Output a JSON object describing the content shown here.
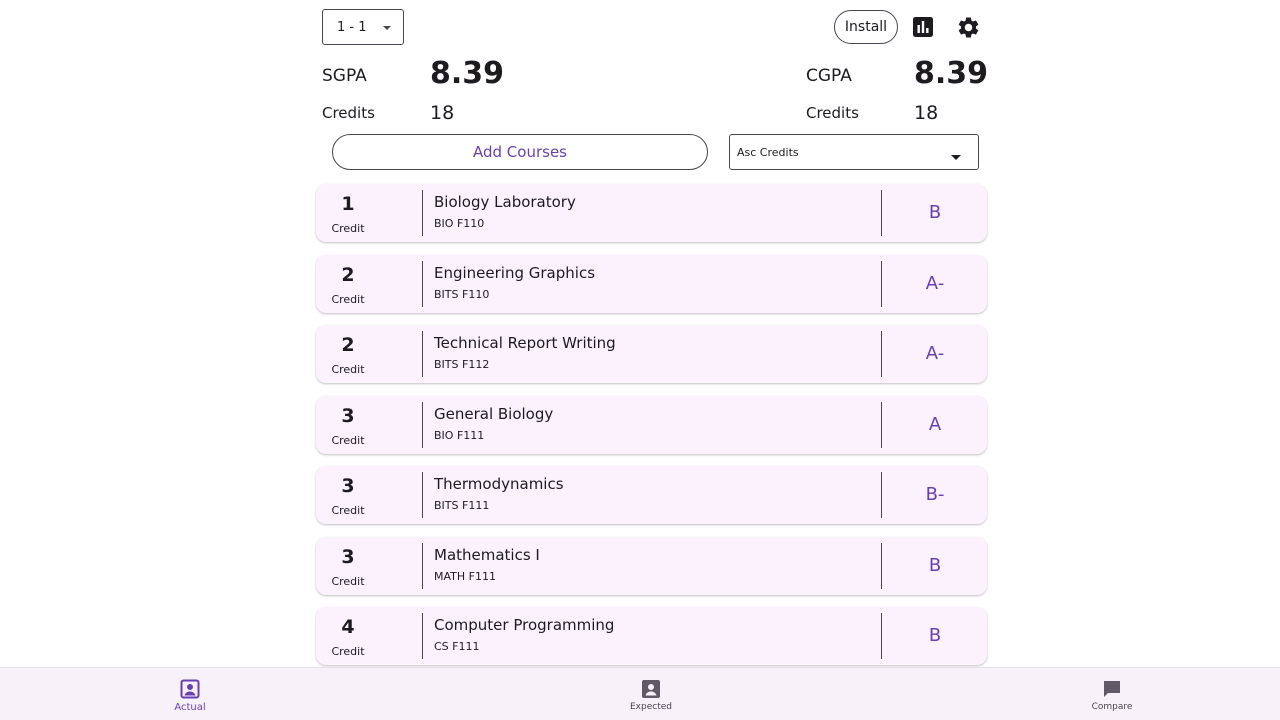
{
  "header": {
    "semester_value": "1 - 1",
    "install_label": "Install",
    "stats_icon": "bar-chart-icon",
    "settings_icon": "gear-icon"
  },
  "sgpa": {
    "label": "SGPA",
    "value": "8.39",
    "credits_label": "Credits",
    "credits_value": "18"
  },
  "cgpa": {
    "label": "CGPA",
    "value": "8.39",
    "credits_label": "Credits",
    "credits_value": "18"
  },
  "controls": {
    "add_courses_label": "Add Courses",
    "sort_value": "Asc Credits"
  },
  "courses": [
    {
      "credits": "1",
      "credit_label": "Credit",
      "name": "Biology Laboratory",
      "code": "BIO F110",
      "grade": "B"
    },
    {
      "credits": "2",
      "credit_label": "Credit",
      "name": "Engineering Graphics",
      "code": "BITS F110",
      "grade": "A-"
    },
    {
      "credits": "2",
      "credit_label": "Credit",
      "name": "Technical Report Writing",
      "code": "BITS F112",
      "grade": "A-"
    },
    {
      "credits": "3",
      "credit_label": "Credit",
      "name": "General Biology",
      "code": "BIO F111",
      "grade": "A"
    },
    {
      "credits": "3",
      "credit_label": "Credit",
      "name": "Thermodynamics",
      "code": "BITS F111",
      "grade": "B-"
    },
    {
      "credits": "3",
      "credit_label": "Credit",
      "name": "Mathematics I",
      "code": "MATH F111",
      "grade": "B"
    },
    {
      "credits": "4",
      "credit_label": "Credit",
      "name": "Computer Programming",
      "code": "CS F111",
      "grade": "B"
    }
  ],
  "nav": {
    "actual_label": "Actual",
    "expected_label": "Expected",
    "compare_label": "Compare"
  },
  "colors": {
    "accent": "#6a3fb1",
    "card_bg": "#fbf2fd",
    "nav_bg": "#f7f2fa"
  }
}
